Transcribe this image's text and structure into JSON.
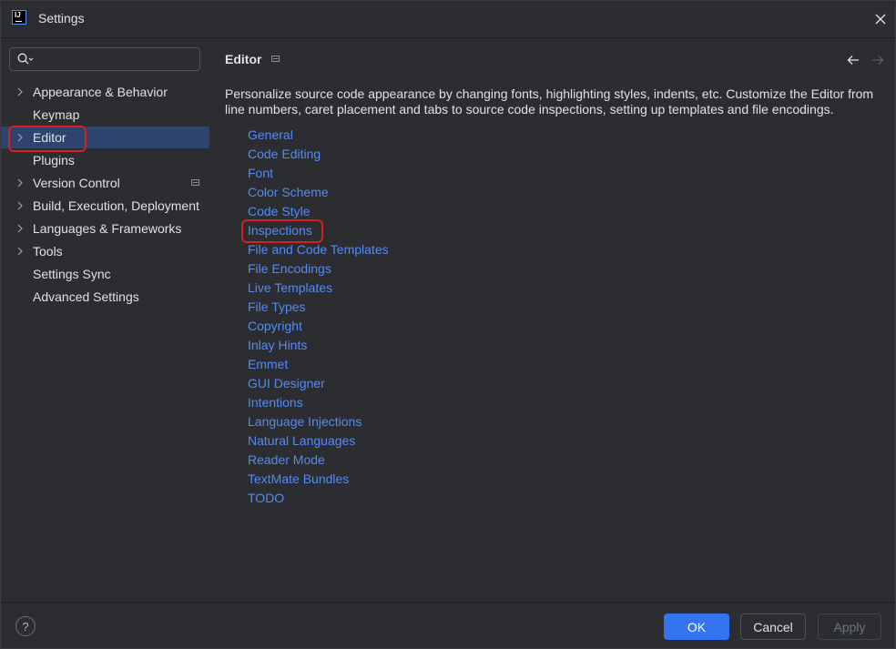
{
  "window": {
    "title": "Settings",
    "app_icon_text": "IJ"
  },
  "sidebar": {
    "search_placeholder": "",
    "items": [
      {
        "label": "Appearance & Behavior",
        "expandable": true
      },
      {
        "label": "Keymap",
        "expandable": false
      },
      {
        "label": "Editor",
        "expandable": true,
        "selected": true
      },
      {
        "label": "Plugins",
        "expandable": false
      },
      {
        "label": "Version Control",
        "expandable": true
      },
      {
        "label": "Build, Execution, Deployment",
        "expandable": true
      },
      {
        "label": "Languages & Frameworks",
        "expandable": true
      },
      {
        "label": "Tools",
        "expandable": true
      },
      {
        "label": "Settings Sync",
        "expandable": false
      },
      {
        "label": "Advanced Settings",
        "expandable": false
      }
    ]
  },
  "main": {
    "title": "Editor",
    "description": "Personalize source code appearance by changing fonts, highlighting styles, indents, etc. Customize the Editor from line numbers, caret placement and tabs to source code inspections, setting up templates and file encodings.",
    "links": [
      "General",
      "Code Editing",
      "Font",
      "Color Scheme",
      "Code Style",
      "Inspections",
      "File and Code Templates",
      "File Encodings",
      "Live Templates",
      "File Types",
      "Copyright",
      "Inlay Hints",
      "Emmet",
      "GUI Designer",
      "Intentions",
      "Language Injections",
      "Natural Languages",
      "Reader Mode",
      "TextMate Bundles",
      "TODO"
    ]
  },
  "footer": {
    "help_label": "?",
    "ok_label": "OK",
    "cancel_label": "Cancel",
    "apply_label": "Apply"
  },
  "colors": {
    "background": "#2b2d30",
    "selection": "#2e436e",
    "link": "#548af7",
    "accent": "#3574f0",
    "annotation": "#d81e1e"
  }
}
